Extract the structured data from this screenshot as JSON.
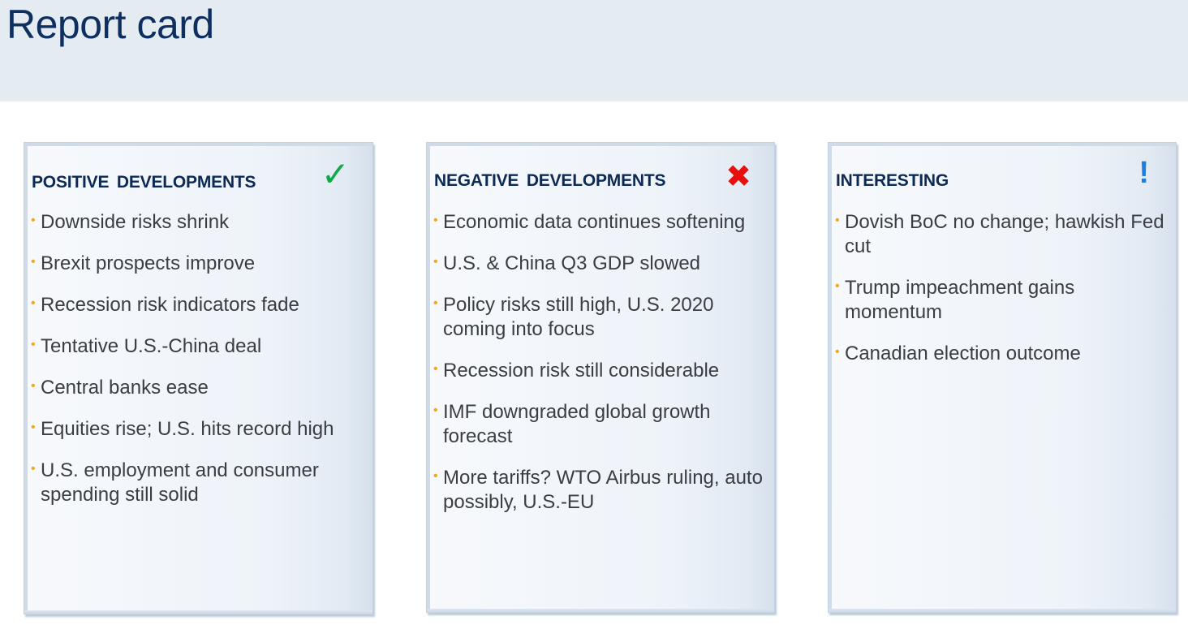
{
  "page": {
    "title": "Report card"
  },
  "colors": {
    "header_background": "#e4ecf1",
    "title": "#0e2f5f",
    "heading": "#0c2a55",
    "bullet_marker": "#f3a81c",
    "check": "#10a84a",
    "cross": "#e8100e",
    "exclamation": "#1a7fe0"
  },
  "cards": {
    "positive": {
      "title": "POSITIVE DEVELOPMENTS",
      "icon": "check-icon",
      "icon_glyph": "✓",
      "items": [
        "Downside risks shrink",
        "Brexit prospects improve",
        "Recession risk indicators fade",
        "Tentative U.S.-China deal",
        "Central banks ease",
        "Equities rise; U.S. hits record high",
        "U.S. employment and consumer spending still solid"
      ]
    },
    "negative": {
      "title": "NEGATIVE DEVELOPMENTS",
      "icon": "cross-icon",
      "icon_glyph": "✖",
      "items": [
        "Economic data continues softening",
        "U.S. & China Q3 GDP slowed",
        "Policy risks still high, U.S. 2020 coming into focus",
        "Recession risk still considerable",
        "IMF downgraded global growth forecast",
        "More tariffs? WTO Airbus ruling, auto possibly, U.S.-EU"
      ]
    },
    "interesting": {
      "title": "INTERESTING",
      "icon": "exclamation-icon",
      "icon_glyph": "!",
      "items": [
        "Dovish BoC no change; hawkish Fed cut",
        "Trump impeachment gains momentum",
        "Canadian election outcome"
      ]
    }
  }
}
